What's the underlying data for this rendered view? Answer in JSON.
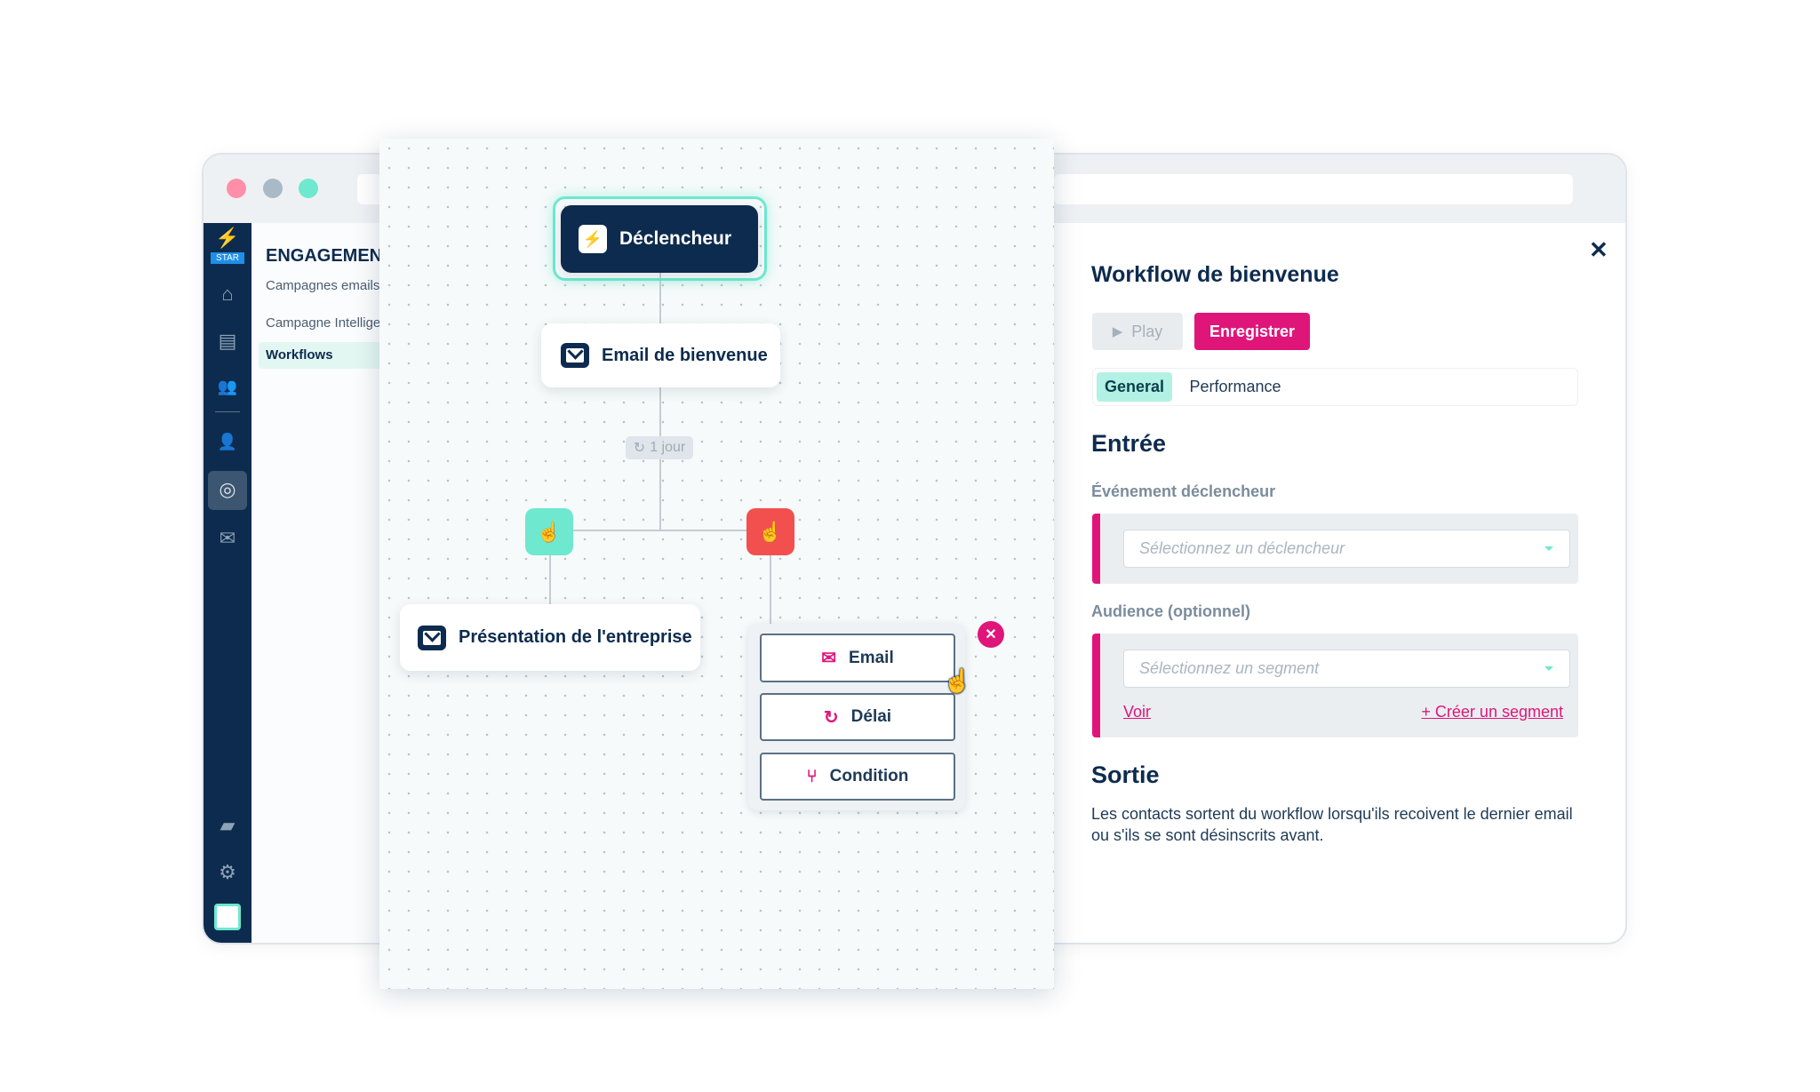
{
  "colors": {
    "navy": "#0d2b4e",
    "accent_pink": "#e0157a",
    "mint": "#6ee8cf",
    "red": "#f2504f"
  },
  "sidebar": {
    "badge": "STAR",
    "icons": [
      "home-icon",
      "book-icon",
      "users-icon",
      "user-plus-icon",
      "target-icon",
      "mail-icon",
      "folder-icon",
      "gear-icon",
      "app-logo"
    ]
  },
  "subnav": {
    "title": "ENGAGEMENT",
    "items": [
      {
        "label": "Campagnes emails"
      },
      {
        "label": "Campagne Intelligente"
      },
      {
        "label": "Workflows",
        "active": true
      }
    ]
  },
  "canvas": {
    "trigger": "Déclencheur",
    "email_node": "Email de bienvenue",
    "delay_badge": "1 jour",
    "branch_node": "Présentation de l'entreprise",
    "add_menu": [
      {
        "label": "Email",
        "icon": "mail-icon"
      },
      {
        "label": "Délai",
        "icon": "clock-icon"
      },
      {
        "label": "Condition",
        "icon": "branch-icon"
      }
    ]
  },
  "panel": {
    "title": "Workflow de bienvenue",
    "play": "Play",
    "save": "Enregistrer",
    "tabs": [
      {
        "label": "General",
        "active": true
      },
      {
        "label": "Performance"
      }
    ],
    "entry_heading": "Entrée",
    "trigger_label": "Événement déclencheur",
    "trigger_placeholder": "Sélectionnez un déclencheur",
    "audience_label": "Audience (optionnel)",
    "audience_placeholder": "Sélectionnez un segment",
    "view_link": "Voir",
    "create_link": "+ Créer un segment",
    "exit_heading": "Sortie",
    "exit_text": "Les contacts sortent du workflow lorsqu'ils recoivent le dernier email ou s'ils se sont désinscrits avant."
  }
}
